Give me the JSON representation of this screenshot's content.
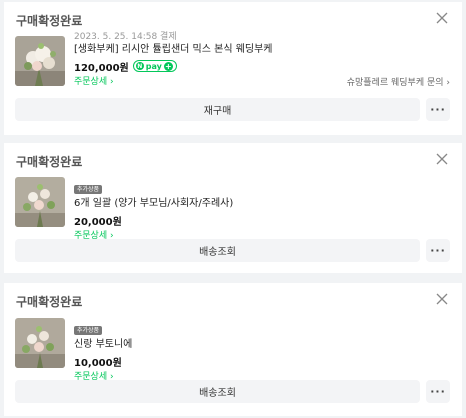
{
  "orders": [
    {
      "status": "구매확정완료",
      "pay_meta": "2023. 5. 25. 14:58 결제",
      "product": "[생화부케] 리시안 튤립샌더 믹스 본식 웨딩부케",
      "price": "120,000원",
      "npay_label": "pay",
      "detail_link": "주문상세 ›",
      "inquiry": "슈망플레르 웨딩부케 문의 ›",
      "action": "재구매",
      "more": "···"
    },
    {
      "status": "구매확정완료",
      "tag": "추가상품",
      "product": "6개 일괄 (양가 부모님/사회자/주례사)",
      "price": "20,000원",
      "detail_link": "주문상세 ›",
      "action": "배송조회",
      "more": "···"
    },
    {
      "status": "구매확정완료",
      "tag": "추가상품",
      "product": "신랑 부토니에",
      "price": "10,000원",
      "detail_link": "주문상세 ›",
      "action": "배송조회",
      "more": "···"
    }
  ],
  "colors": {
    "accent_green": "#03c75a",
    "button_bg": "#f3f4f6",
    "page_bg": "#f1f3f5"
  }
}
